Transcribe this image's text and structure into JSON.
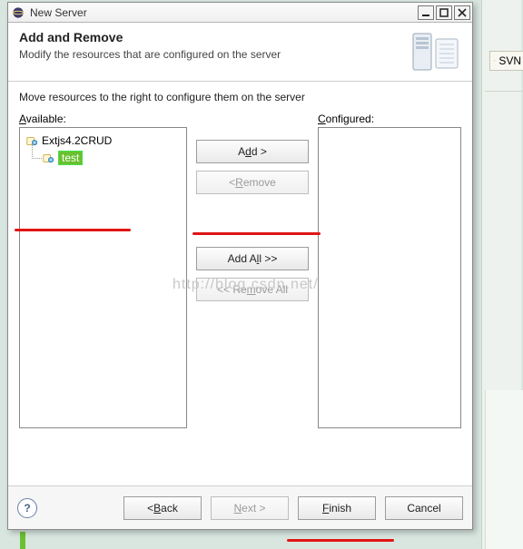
{
  "window": {
    "title": "New Server"
  },
  "header": {
    "title": "Add and Remove",
    "subtitle": "Modify the resources that are configured on the server"
  },
  "body": {
    "instruction": "Move resources to the right to configure them on the server",
    "available_label_pre": "A",
    "available_label_post": "vailable:",
    "configured_label_pre": "C",
    "configured_label_post": "onfigured:",
    "available_items": [
      {
        "label": "Extjs4.2CRUD",
        "selected": false
      },
      {
        "label": "test",
        "selected": true
      }
    ],
    "configured_items": []
  },
  "buttons": {
    "add_pre": "A",
    "add_mid": "d",
    "add_post": "d >",
    "remove_pre": "< ",
    "remove_mid": "R",
    "remove_post": "emove",
    "addall_pre": "Add A",
    "addall_mid": "l",
    "addall_post": "l >>",
    "removeall_pre": "<< Re",
    "removeall_mid": "m",
    "removeall_post": "ove All"
  },
  "footer": {
    "help_char": "?",
    "back_pre": "< ",
    "back_mid": "B",
    "back_post": "ack",
    "next_pre": "",
    "next_mid": "N",
    "next_post": "ext >",
    "finish_pre": "",
    "finish_mid": "F",
    "finish_post": "inish",
    "cancel": "Cancel"
  },
  "bg": {
    "svn_label": "SVN"
  },
  "watermark": "http://blog.csdn.net/"
}
